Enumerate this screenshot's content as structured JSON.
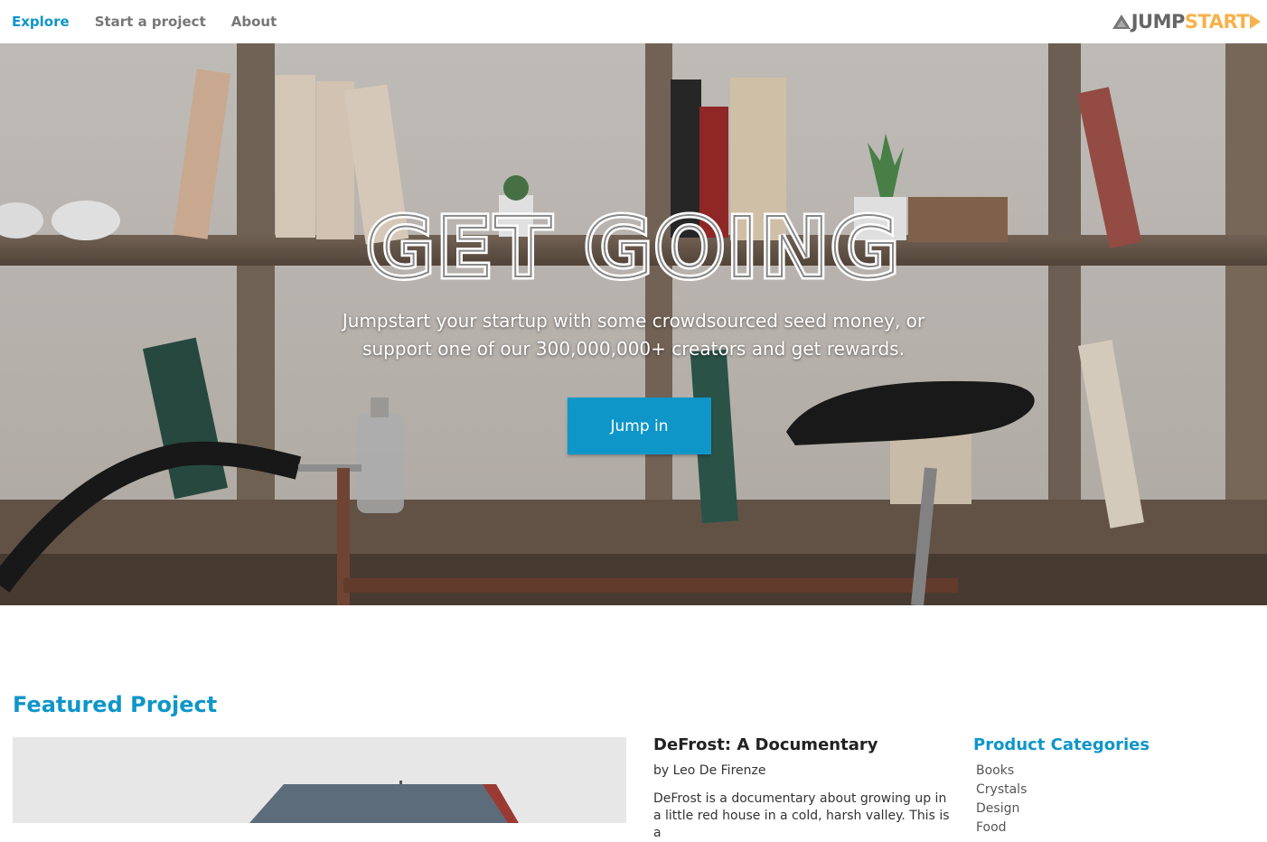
{
  "nav": {
    "links": [
      {
        "label": "Explore",
        "active": true
      },
      {
        "label": "Start a project",
        "active": false
      },
      {
        "label": "About",
        "active": false
      }
    ],
    "logo": {
      "part1": "JUMP",
      "part2": "START"
    }
  },
  "hero": {
    "title": "GET GOING",
    "subtitle_line1": "Jumpstart your startup with some crowdsourced seed money, or",
    "subtitle_line2": "support one of our 300,000,000+ creators and get rewards.",
    "button_label": "Jump in"
  },
  "featured": {
    "section_title": "Featured Project",
    "project_name": "DeFrost: A Documentary",
    "author": "by Leo De Firenze",
    "description": "DeFrost is a documentary about growing up in a little red house in a cold, harsh valley. This is a"
  },
  "categories": {
    "title": "Product Categories",
    "items": [
      "Books",
      "Crystals",
      "Design",
      "Food"
    ]
  },
  "colors": {
    "accent": "#0e96c9",
    "logo_orange": "#f6b24a",
    "nav_gray": "#777777"
  }
}
